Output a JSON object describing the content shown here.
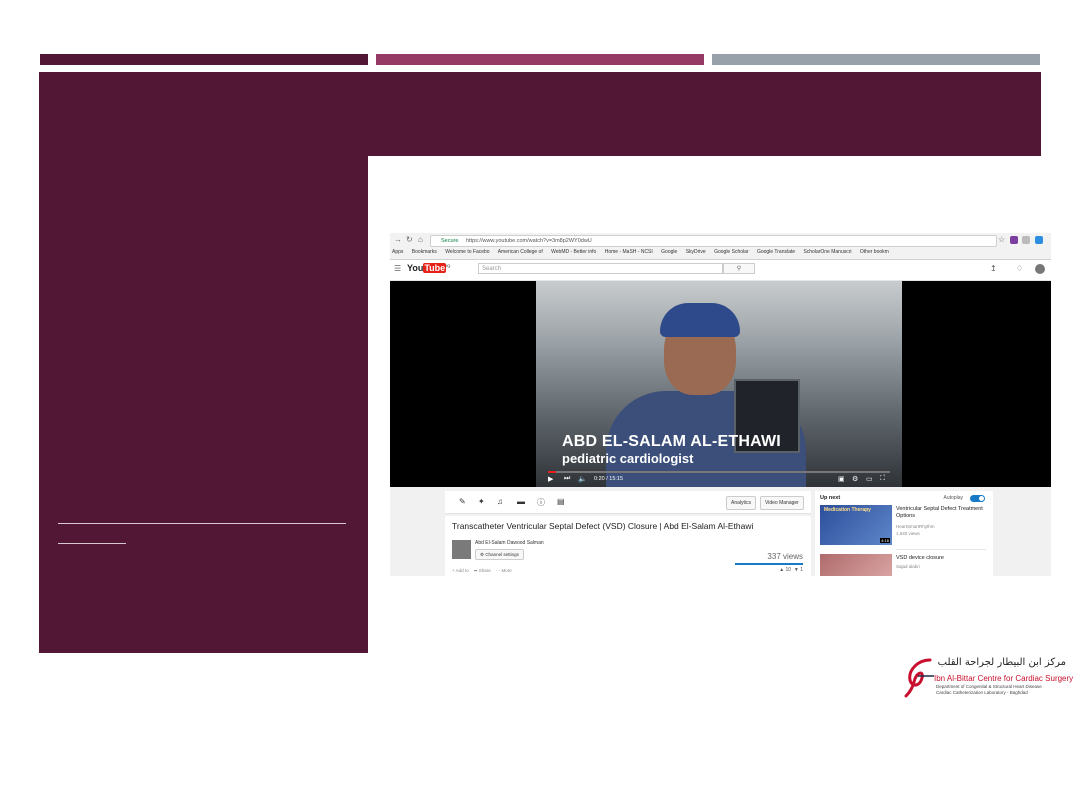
{
  "slide": {
    "colors": {
      "plum": "#511735",
      "magenta": "#953a65",
      "gray": "#98a1a9"
    }
  },
  "browser": {
    "secure_label": "Secure",
    "url": "https://www.youtube.com/watch?v=3m8p2WY0dwU",
    "bookmarks": [
      "Apps",
      "Bookmarks",
      "Welcome to Facebo",
      "American College of",
      "WebMD - Better info",
      "Home - MaSH - NCSI",
      "Google",
      "SkyDrive",
      "Google Scholar",
      "Google Translate",
      "ScholarOne Manuscri",
      "Other bookm"
    ]
  },
  "youtube": {
    "logo_you": "You",
    "logo_tube": "Tube",
    "logo_region": "IQ",
    "search_placeholder": "Search",
    "video": {
      "overlay_name": "ABD EL-SALAM AL-ETHAWI",
      "overlay_role": "pediatric cardiologist",
      "time": "0:20 / 15:15",
      "progress": 0.022
    },
    "studio_buttons": [
      "Analytics",
      "Video Manager"
    ],
    "title": "Transcatheter Ventricular Septal Defect (VSD) Closure | Abd El-Salam Al-Ethawi",
    "channel": "Abd El-Salam Dawood Salman",
    "channel_settings": "Channel settings",
    "views": "337 views",
    "actions": [
      "Add to",
      "Share",
      "More"
    ],
    "likes": "10",
    "dislikes": "1",
    "up_next": {
      "heading": "Up next",
      "autoplay": "Autoplay",
      "items": [
        {
          "thumb_label": "Medication Therapy",
          "title": "Ventricular Septal Defect Treatment Options",
          "channel": "HeartSmartRhythm",
          "views": "1,640 views",
          "duration": "4:16"
        },
        {
          "title": "VSD device closure",
          "channel": "Sajad alabri"
        }
      ]
    }
  },
  "footer_logo": {
    "arabic": "مركز ابن البيطار لجراحة القلب",
    "name": "Ibn Al-Bittar Centre for Cardiac Surgery",
    "dept": "Department of Congenital & Structural Heart Disease",
    "lab": "Cardiac Catheterization Laboratory - Baghdad"
  }
}
